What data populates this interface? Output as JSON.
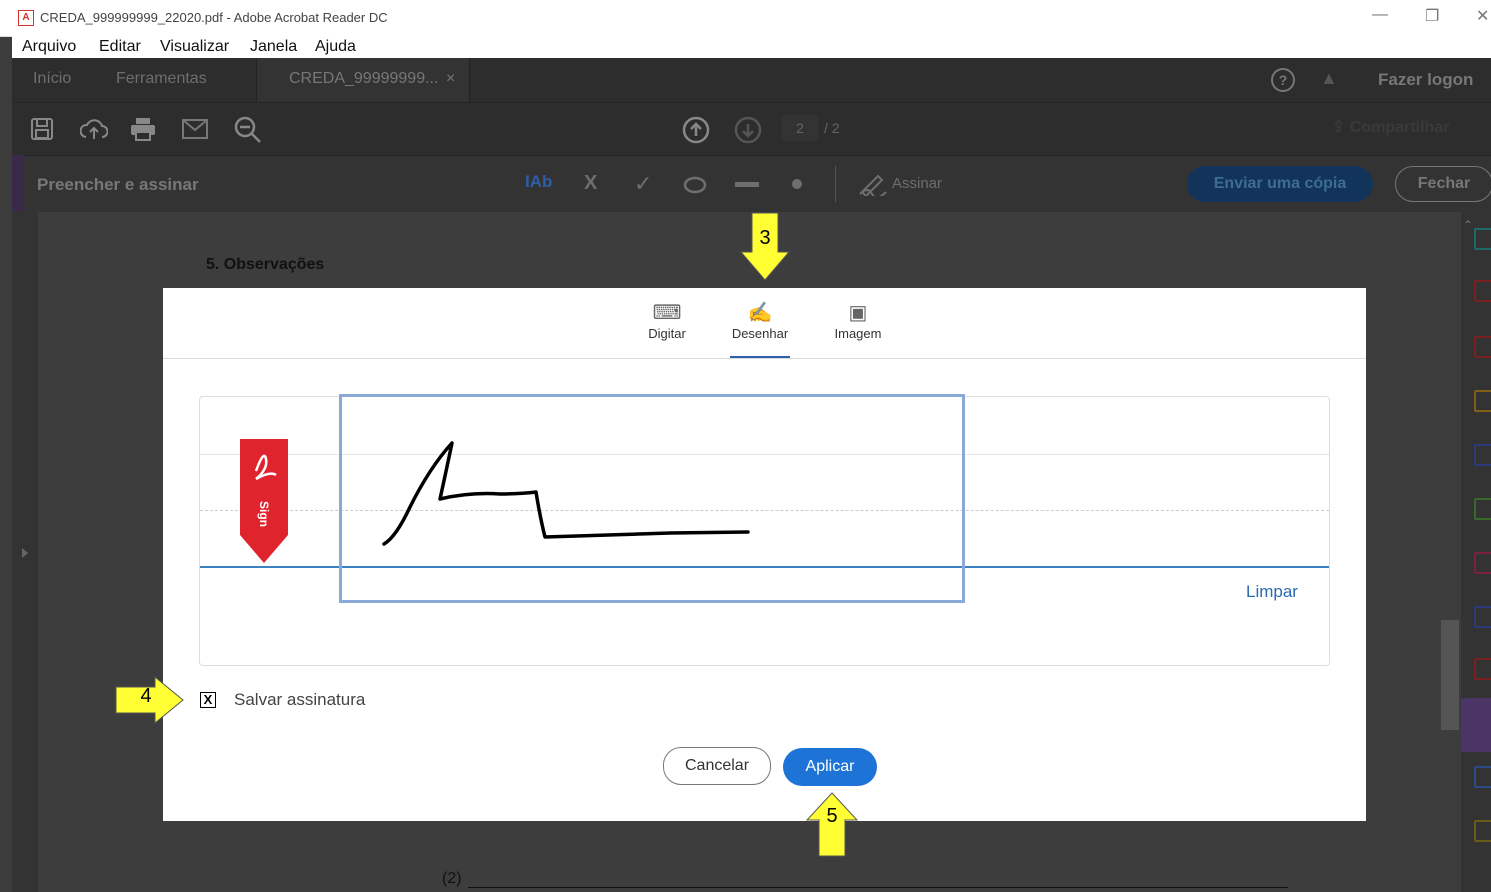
{
  "window": {
    "title": "CREDA_999999999_22020.pdf - Adobe Acrobat Reader DC",
    "controls": [
      "—",
      "❐",
      "✕"
    ]
  },
  "menu": [
    "Arquivo",
    "Editar",
    "Visualizar",
    "Janela",
    "Ajuda"
  ],
  "tabs": {
    "home": "Início",
    "tools": "Ferramentas",
    "document": "CREDA_99999999...",
    "close_glyph": "×",
    "login": "Fazer logon"
  },
  "toolbar": {
    "page_current": "2",
    "page_total": "/ 2",
    "share": "Compartilhar"
  },
  "fillsign": {
    "title": "Preencher e assinar",
    "text_tool": "IAb",
    "cross": "X",
    "check": "✓",
    "sign_label": "Assinar",
    "send_copy": "Enviar uma cópia",
    "close": "Fechar"
  },
  "document": {
    "section_heading": "5. Observações",
    "footer_marker": "(2)"
  },
  "dialog": {
    "tabs": [
      "Digitar",
      "Desenhar",
      "Imagem"
    ],
    "active_tab_index": 1,
    "sign_tag": "Sign",
    "clear": "Limpar",
    "save_signature": "Salvar assinatura",
    "save_checked": true,
    "cancel": "Cancelar",
    "apply": "Aplicar"
  },
  "annotations": {
    "step3": "3",
    "step4": "4",
    "step5": "5"
  },
  "colors": {
    "accent_blue": "#1e74d6",
    "link_blue": "#2b6cb0",
    "sign_red": "#e0242d",
    "callout_yellow": "#ffff33"
  }
}
